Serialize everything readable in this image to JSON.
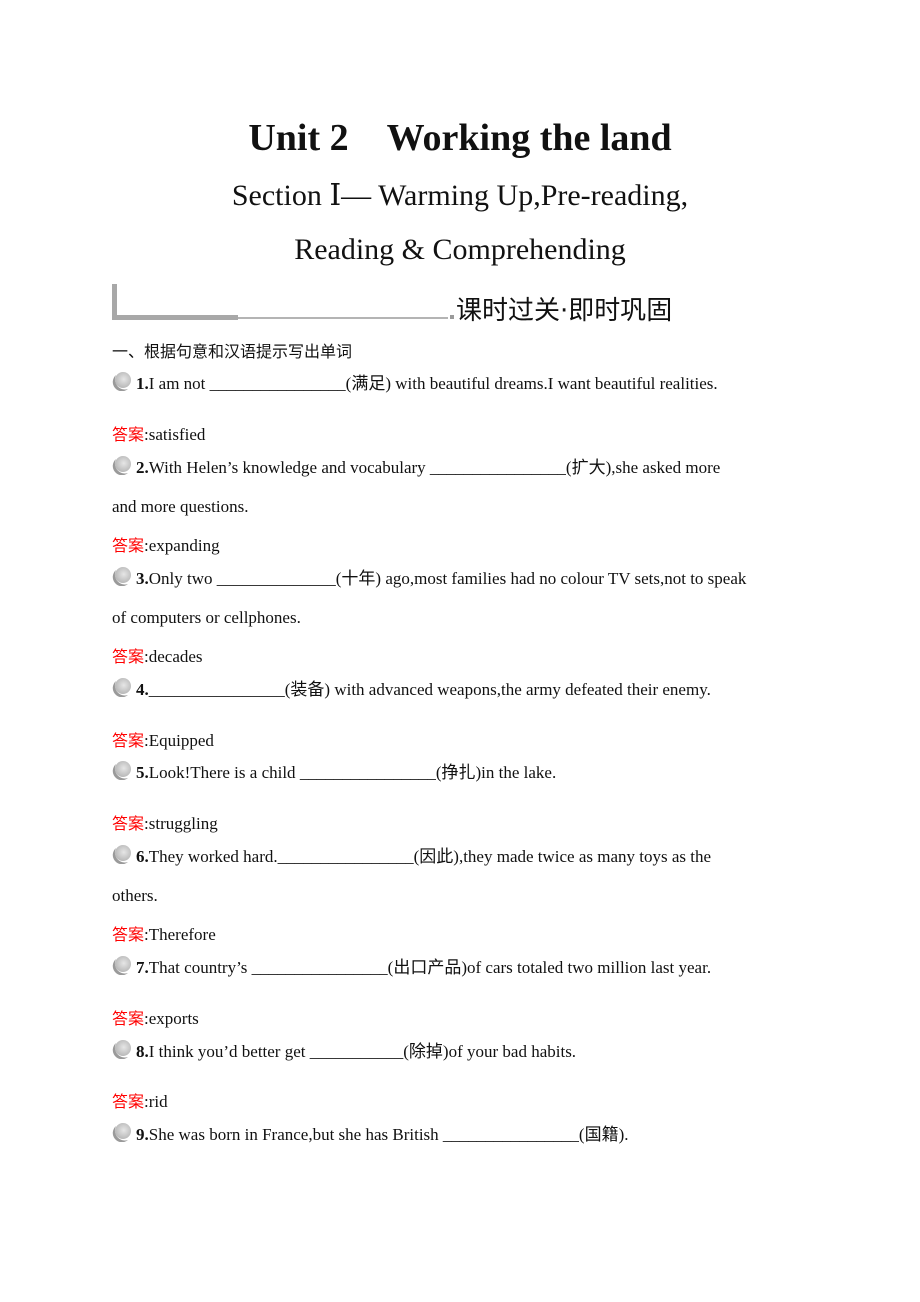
{
  "header": {
    "title_unit": "Unit 2",
    "title_name": "Working the land",
    "subtitle_line1": "Section Ⅰ— Warming Up,Pre-reading,",
    "subtitle_line2": "Reading & Comprehending",
    "banner_text": "课时过关·即时巩固",
    "section_heading": "一、根据句意和汉语提示写出单词"
  },
  "answer_label": "答案",
  "answer_sep": ":",
  "questions": [
    {
      "num": "1.",
      "before": "I am not ",
      "blank": "________________",
      "hint": "(满足)",
      "after": " with beautiful dreams.I want beautiful realities.",
      "cont": "",
      "answer": "satisfied"
    },
    {
      "num": "2.",
      "before": "With Helen’s knowledge and vocabulary ",
      "blank": "________________",
      "hint": "(扩大)",
      "after": ",she asked more",
      "cont": "and more questions.",
      "answer": "expanding"
    },
    {
      "num": "3.",
      "before": "Only two ",
      "blank": "______________",
      "hint": "(十年)",
      "after": " ago,most families had no colour TV sets,not to speak",
      "cont": "of computers or cellphones.",
      "answer": "decades"
    },
    {
      "num": "4.",
      "before": "",
      "blank": "________________",
      "hint": "(装备)",
      "after": " with advanced weapons,the army defeated their enemy.",
      "cont": "",
      "answer": "Equipped"
    },
    {
      "num": "5.",
      "before": "Look!There is a child ",
      "blank": "________________",
      "hint": "(挣扎)",
      "after": "in the lake.",
      "cont": "",
      "answer": "struggling"
    },
    {
      "num": "6.",
      "before": "They worked hard.",
      "blank": "________________",
      "hint": "(因此)",
      "after": ",they made twice as many toys as the",
      "cont": "others.",
      "answer": "Therefore"
    },
    {
      "num": "7.",
      "before": "That country’s ",
      "blank": "________________",
      "hint": "(出口产品)",
      "after": "of cars totaled two million last year.",
      "cont": "",
      "answer": "exports"
    },
    {
      "num": "8.",
      "before": "I think you’d better get ",
      "blank": "___________",
      "hint": "(除掉)",
      "after": "of your bad habits.",
      "cont": "",
      "answer": "rid"
    },
    {
      "num": "9.",
      "before": "She was born in France,but she has British ",
      "blank": "________________",
      "hint": "(国籍)",
      "after": ".",
      "cont": "",
      "answer": ""
    }
  ]
}
